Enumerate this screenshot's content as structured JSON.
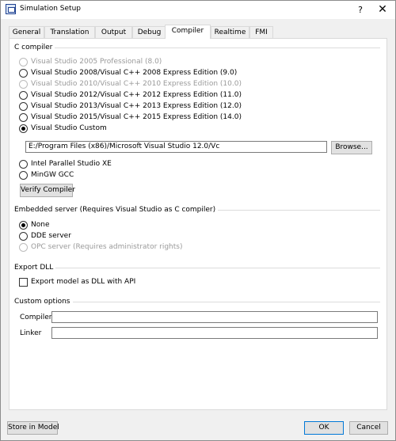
{
  "window": {
    "title": "Simulation Setup",
    "help_glyph": "?",
    "close_glyph": "✕"
  },
  "tabs": [
    {
      "label": "General"
    },
    {
      "label": "Translation"
    },
    {
      "label": "Output"
    },
    {
      "label": "Debug"
    },
    {
      "label": "Compiler",
      "active": true
    },
    {
      "label": "Realtime"
    },
    {
      "label": "FMI"
    }
  ],
  "c_compiler": {
    "title": "C compiler",
    "options": [
      {
        "label": "Visual Studio 2005 Professional (8.0)",
        "enabled": false,
        "selected": false
      },
      {
        "label": "Visual Studio 2008/Visual C++ 2008 Express Edition (9.0)",
        "enabled": true,
        "selected": false
      },
      {
        "label": "Visual Studio 2010/Visual C++ 2010 Express Edition (10.0)",
        "enabled": false,
        "selected": false
      },
      {
        "label": "Visual Studio 2012/Visual C++ 2012 Express Edition (11.0)",
        "enabled": true,
        "selected": false
      },
      {
        "label": "Visual Studio 2013/Visual C++ 2013 Express Edition (12.0)",
        "enabled": true,
        "selected": false
      },
      {
        "label": "Visual Studio 2015/Visual C++ 2015 Express Edition (14.0)",
        "enabled": true,
        "selected": false
      },
      {
        "label": "Visual Studio Custom",
        "enabled": true,
        "selected": true
      }
    ],
    "path_value": "E:/Program Files (x86)/Microsoft Visual Studio 12.0/Vc",
    "browse_label": "Browse...",
    "other_options": [
      {
        "label": "Intel Parallel Studio XE",
        "enabled": true,
        "selected": false
      },
      {
        "label": "MinGW GCC",
        "enabled": true,
        "selected": false
      }
    ],
    "verify_label": "Verify Compiler"
  },
  "embedded_server": {
    "title": "Embedded server (Requires Visual Studio as C compiler)",
    "options": [
      {
        "label": "None",
        "enabled": true,
        "selected": true
      },
      {
        "label": "DDE server",
        "enabled": true,
        "selected": false
      },
      {
        "label": "OPC server (Requires administrator rights)",
        "enabled": false,
        "selected": false
      }
    ]
  },
  "export_dll": {
    "title": "Export DLL",
    "checkbox_label": "Export model as DLL with API",
    "checked": false
  },
  "custom_options": {
    "title": "Custom options",
    "compiler_label": "Compiler",
    "compiler_value": "",
    "linker_label": "Linker",
    "linker_value": ""
  },
  "footer": {
    "store_label": "Store in Model",
    "ok_label": "OK",
    "cancel_label": "Cancel"
  }
}
